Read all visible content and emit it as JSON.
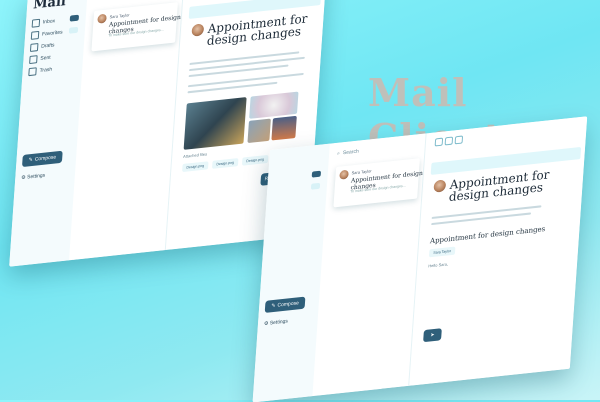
{
  "headline": "Mail Client",
  "app": {
    "name": "Mail"
  },
  "nav": {
    "inbox": "Inbox",
    "favorites": "Favorites",
    "drafts": "Drafts",
    "sent": "Sent",
    "trash": "Trash"
  },
  "sidebar": {
    "compose": "Compose",
    "settings": "Settings"
  },
  "search": {
    "placeholder": "Search"
  },
  "message": {
    "sender": "Sara Taylor",
    "subject": "Appointment for design changes",
    "preview": "To make sure our design changes..."
  },
  "reader": {
    "title": "Appointment for design changes",
    "reply": "Reply to Sara"
  },
  "attachments": {
    "label": "Attached files",
    "items": [
      "Design.png",
      "Design.png",
      "Design.png",
      "Design.png"
    ]
  },
  "reply_draft": {
    "subject": "Appointment for design changes",
    "greeting": "Hello Sara,"
  },
  "colors": {
    "accent": "#2f5f7a",
    "background": "#7eeaf5",
    "highlight": "#dff7fb"
  }
}
